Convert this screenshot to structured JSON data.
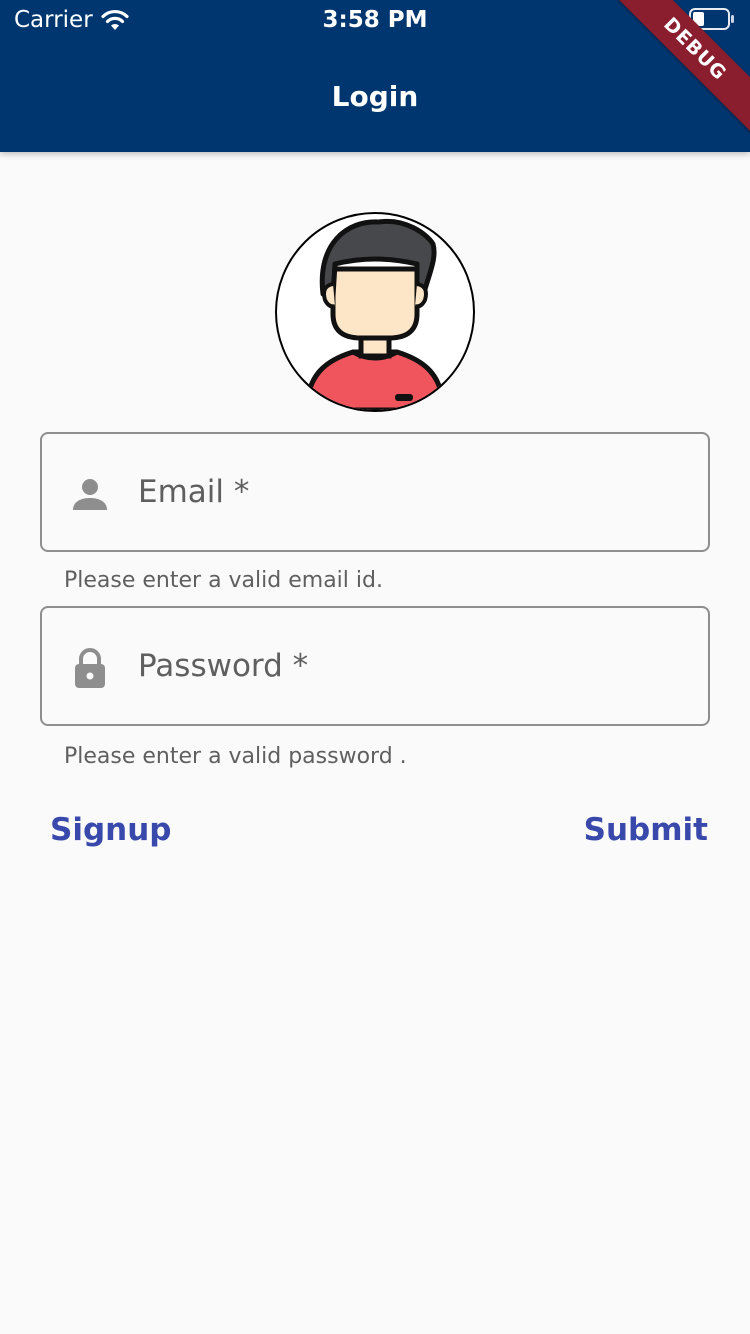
{
  "status_bar": {
    "carrier": "Carrier",
    "time": "3:58 PM"
  },
  "app_bar": {
    "title": "Login",
    "debug_banner": "DEBUG",
    "background_color": "#00366f"
  },
  "avatar": {
    "icon": "user-avatar-icon"
  },
  "form": {
    "email": {
      "label": "Email *",
      "icon": "person-icon",
      "helper": "Please enter a valid email id."
    },
    "password": {
      "label": "Password *",
      "icon": "lock-icon",
      "helper": "Please enter a valid password ."
    }
  },
  "actions": {
    "signup_label": "Signup",
    "submit_label": "Submit",
    "accent_color": "#3949ab"
  }
}
